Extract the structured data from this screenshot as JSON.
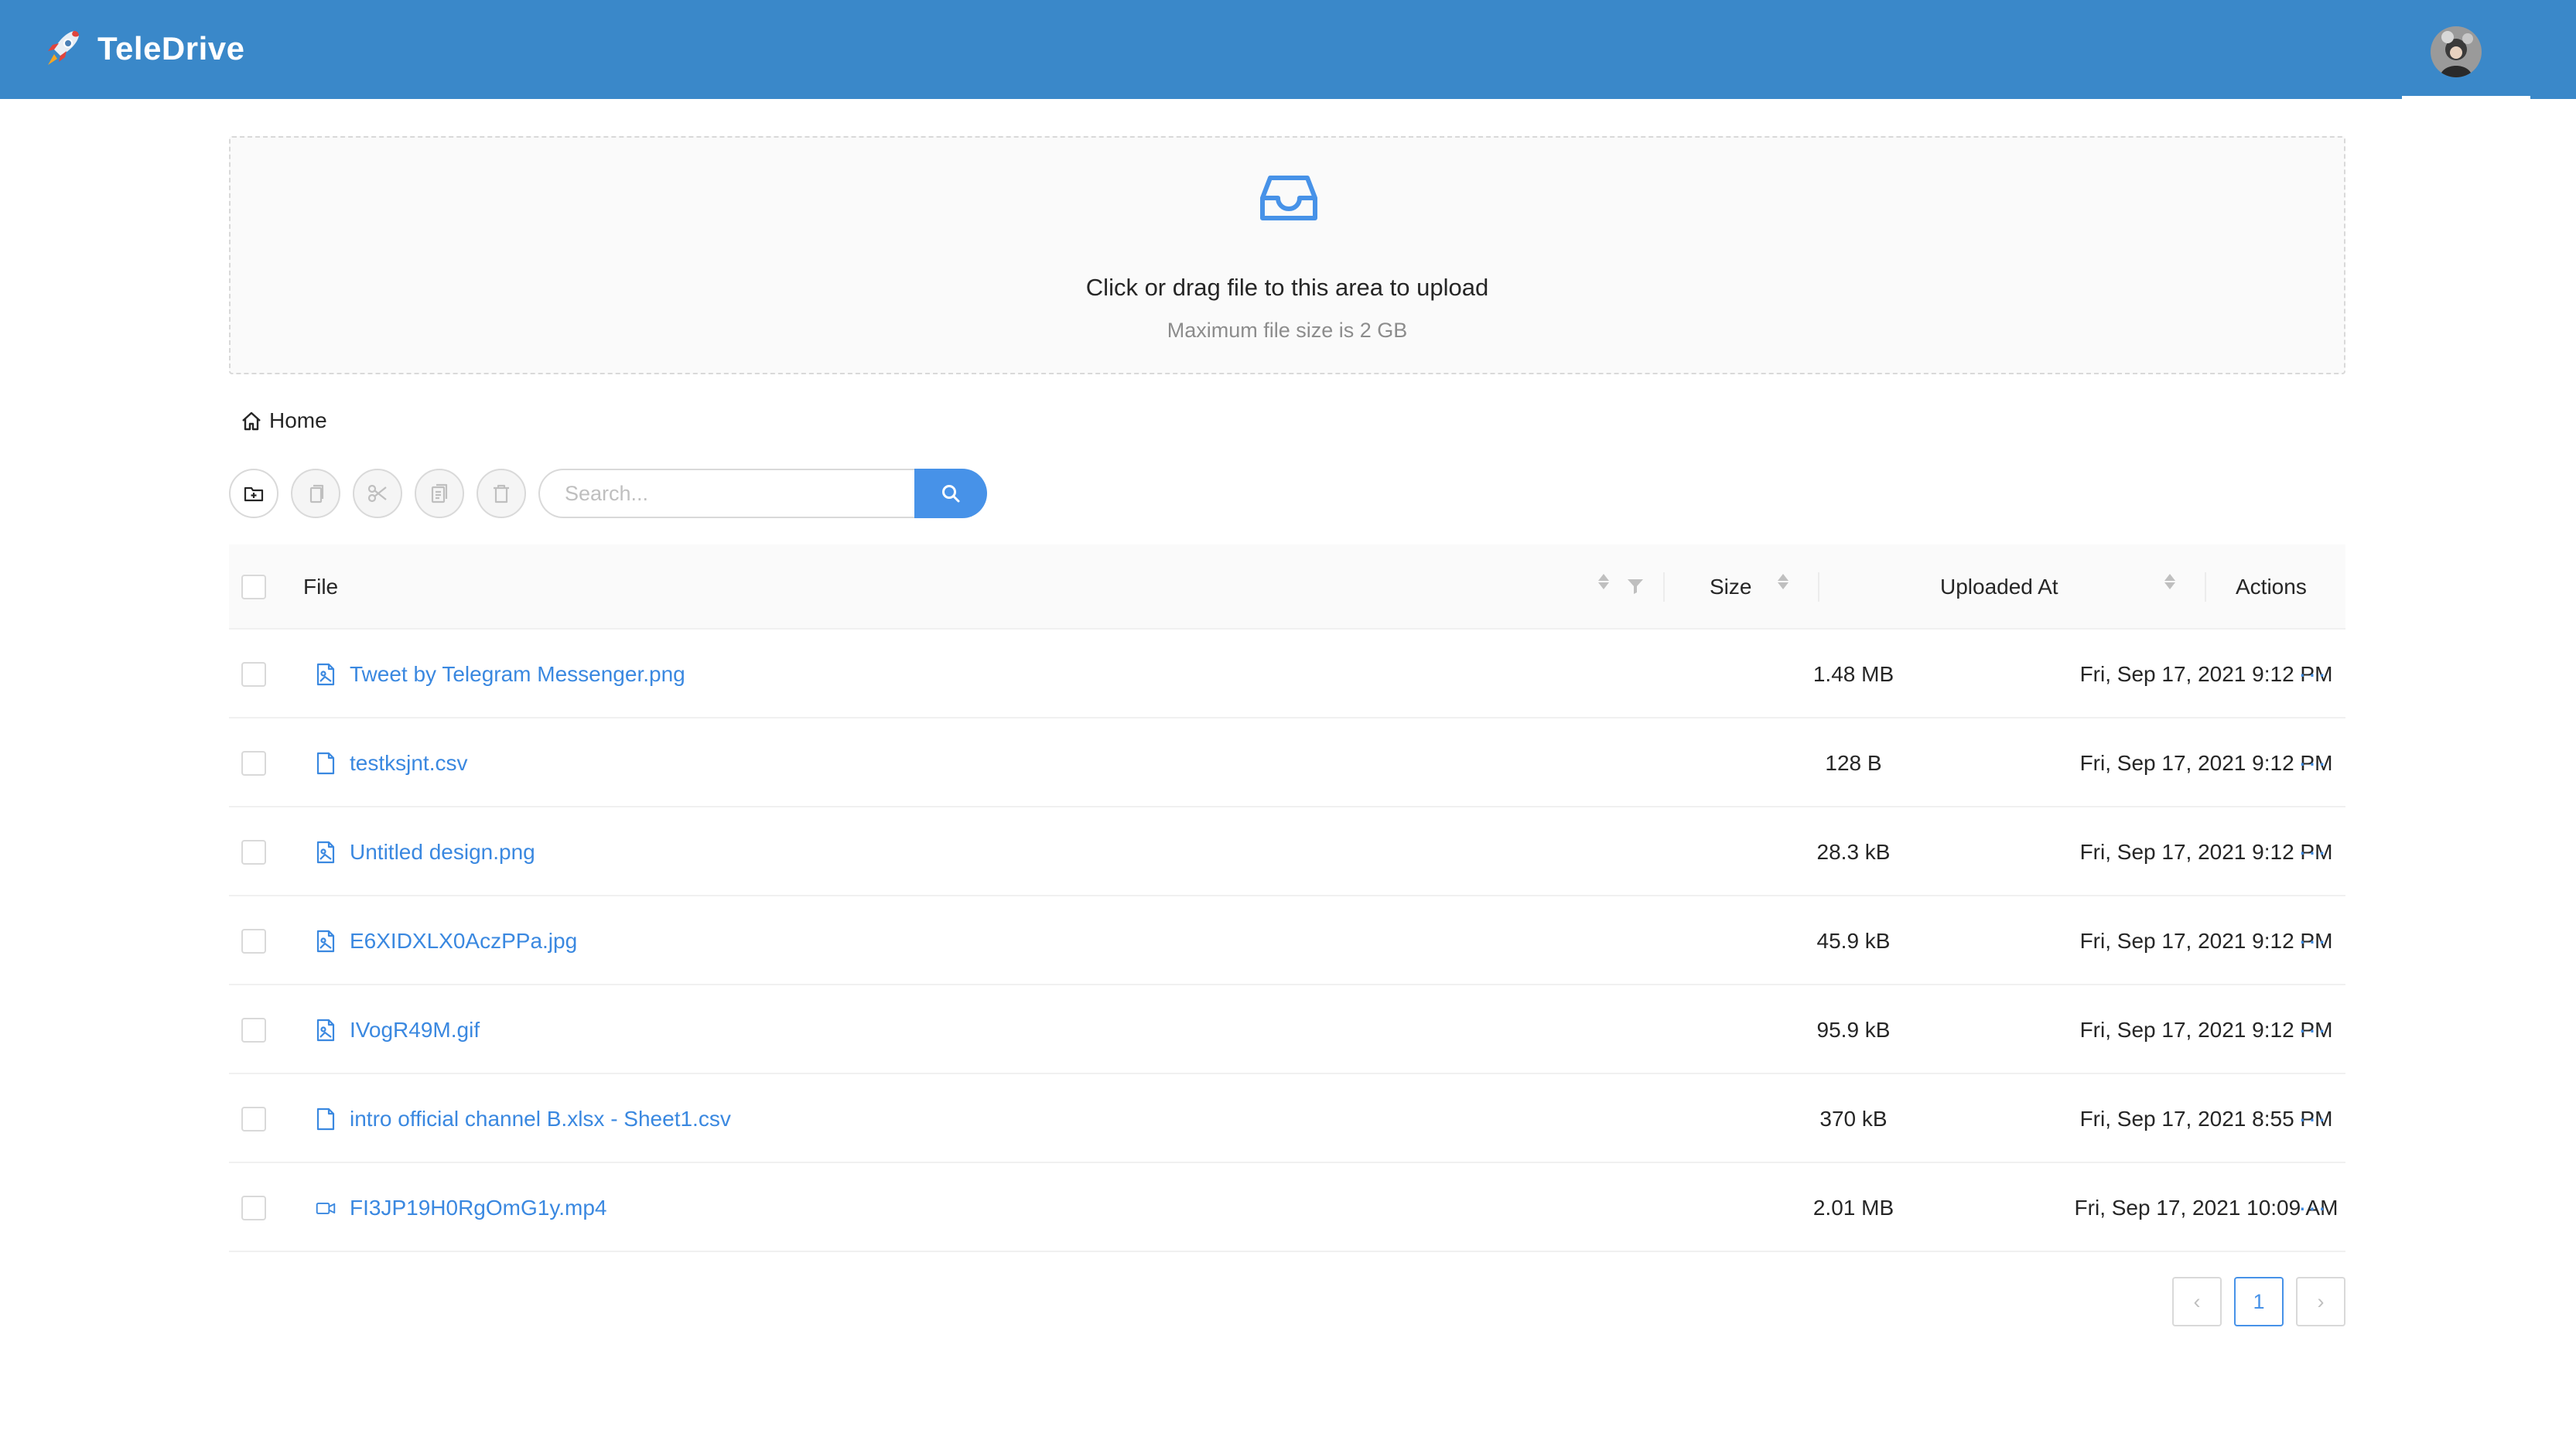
{
  "app": {
    "name": "TeleDrive",
    "colors": {
      "header": "#3a88c9",
      "accent": "#4792e8",
      "link": "#3a88e0"
    }
  },
  "upload": {
    "title": "Click or drag file to this area to upload",
    "hint": "Maximum file size is 2 GB",
    "icon": "inbox-icon"
  },
  "breadcrumb": {
    "home_label": "Home",
    "icon": "home-icon"
  },
  "toolbar": {
    "buttons": [
      {
        "name": "new-folder-button",
        "icon": "folder-add-icon",
        "enabled": true
      },
      {
        "name": "copy-button",
        "icon": "copy-icon",
        "enabled": false
      },
      {
        "name": "cut-button",
        "icon": "scissor-icon",
        "enabled": false
      },
      {
        "name": "paste-button",
        "icon": "snippets-icon",
        "enabled": false
      },
      {
        "name": "delete-button",
        "icon": "delete-icon",
        "enabled": false
      }
    ],
    "search_placeholder": "Search..."
  },
  "table": {
    "columns": {
      "file": "File",
      "size": "Size",
      "uploaded_at": "Uploaded At",
      "actions": "Actions"
    },
    "rows": [
      {
        "name": "Tweet by Telegram Messenger.png",
        "type": "image",
        "size": "1.48 MB",
        "uploaded_at": "Fri, Sep 17, 2021 9:12 PM",
        "actions": "···"
      },
      {
        "name": "testksjnt.csv",
        "type": "file",
        "size": "128 B",
        "uploaded_at": "Fri, Sep 17, 2021 9:12 PM",
        "actions": "···"
      },
      {
        "name": "Untitled design.png",
        "type": "image",
        "size": "28.3 kB",
        "uploaded_at": "Fri, Sep 17, 2021 9:12 PM",
        "actions": "···"
      },
      {
        "name": "E6XIDXLX0AczPPa.jpg",
        "type": "image",
        "size": "45.9 kB",
        "uploaded_at": "Fri, Sep 17, 2021 9:12 PM",
        "actions": "···"
      },
      {
        "name": "IVogR49M.gif",
        "type": "image",
        "size": "95.9 kB",
        "uploaded_at": "Fri, Sep 17, 2021 9:12 PM",
        "actions": "···"
      },
      {
        "name": "intro official channel B.xlsx - Sheet1.csv",
        "type": "file",
        "size": "370 kB",
        "uploaded_at": "Fri, Sep 17, 2021 8:55 PM",
        "actions": "···"
      },
      {
        "name": "FI3JP19H0RgOmG1y.mp4",
        "type": "video",
        "size": "2.01 MB",
        "uploaded_at": "Fri, Sep 17, 2021 10:09 AM",
        "actions": "···"
      }
    ]
  },
  "pagination": {
    "prev": "‹",
    "current": "1",
    "next": "›"
  }
}
